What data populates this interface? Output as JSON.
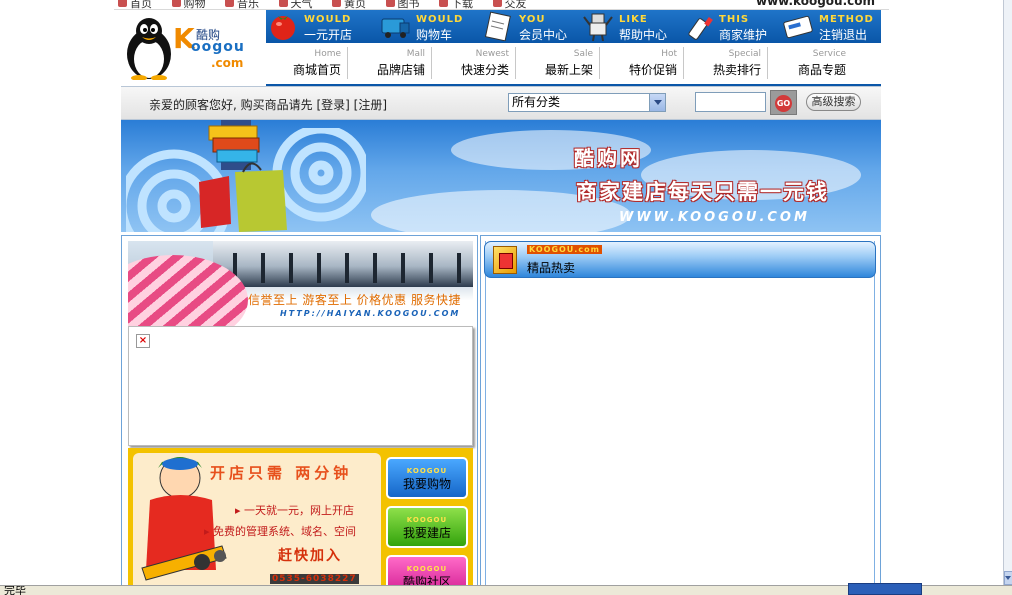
{
  "browser_top": {
    "links": [
      "首页",
      "购物",
      "音乐",
      "天气",
      "黄页",
      "图书",
      "下载",
      "交友"
    ],
    "domain": "www.koogou.com"
  },
  "logo": {
    "k": "K",
    "oogou": "oogou",
    "com": ".com",
    "brand": "酷购"
  },
  "topnav": [
    {
      "en": "WOULD",
      "cn": "一元开店",
      "icon": "tomato-icon"
    },
    {
      "en": "WOULD",
      "cn": "购物车",
      "icon": "cart-truck-icon"
    },
    {
      "en": "YOU",
      "cn": "会员中心",
      "icon": "clipboard-icon"
    },
    {
      "en": "LIKE",
      "cn": "帮助中心",
      "icon": "robot-icon"
    },
    {
      "en": "THIS",
      "cn": "商家维护",
      "icon": "glue-icon"
    },
    {
      "en": "METHOD",
      "cn": "注销退出",
      "icon": "ticket-icon"
    }
  ],
  "subnav": [
    {
      "en": "Home",
      "cn": "商城首页"
    },
    {
      "en": "Mall",
      "cn": "品牌店铺"
    },
    {
      "en": "Newest",
      "cn": "快速分类"
    },
    {
      "en": "Sale",
      "cn": "最新上架"
    },
    {
      "en": "Hot",
      "cn": "特价促销"
    },
    {
      "en": "Special",
      "cn": "热卖排行"
    },
    {
      "en": "Service",
      "cn": "商品专题"
    }
  ],
  "search": {
    "welcome_prefix": "亲爱的顾客您好, 购买商品请先",
    "login": "[登录]",
    "register": "[注册]",
    "category_selected": "所有分类",
    "keyword_value": "",
    "go_label": "GO",
    "advanced_label": "高级搜索"
  },
  "banner": {
    "site_name": "酷购网",
    "tagline": "商家建店每天只需一元钱",
    "url": "WWW.KOOGOU.COM"
  },
  "promo": {
    "slogan": "信誉至上  游客至上  价格优惠  服务快捷",
    "url": "HTTP://HAIYAN.KOOGOU.COM"
  },
  "shop_ad": {
    "headline": "开店只需 两分钟",
    "line1": "一天就一元，网上开店",
    "line2": "免费的管理系统、域名、空间",
    "join": "赶快加入",
    "phone": "0535-6038227",
    "buttons": [
      {
        "en": "KOOGOU",
        "cn": "我要购物"
      },
      {
        "en": "KOOGOU",
        "cn": "我要建店"
      },
      {
        "en": "KOOGOU",
        "cn": "酷购社区"
      }
    ]
  },
  "hot_panel": {
    "en": "KOOGOU.com",
    "title": "精品热卖"
  },
  "status": {
    "text": "完毕"
  },
  "colors": {
    "nav_blue": "#0a56a8",
    "accent_orange": "#f08a00",
    "accent_yellow": "#ffd83a"
  }
}
